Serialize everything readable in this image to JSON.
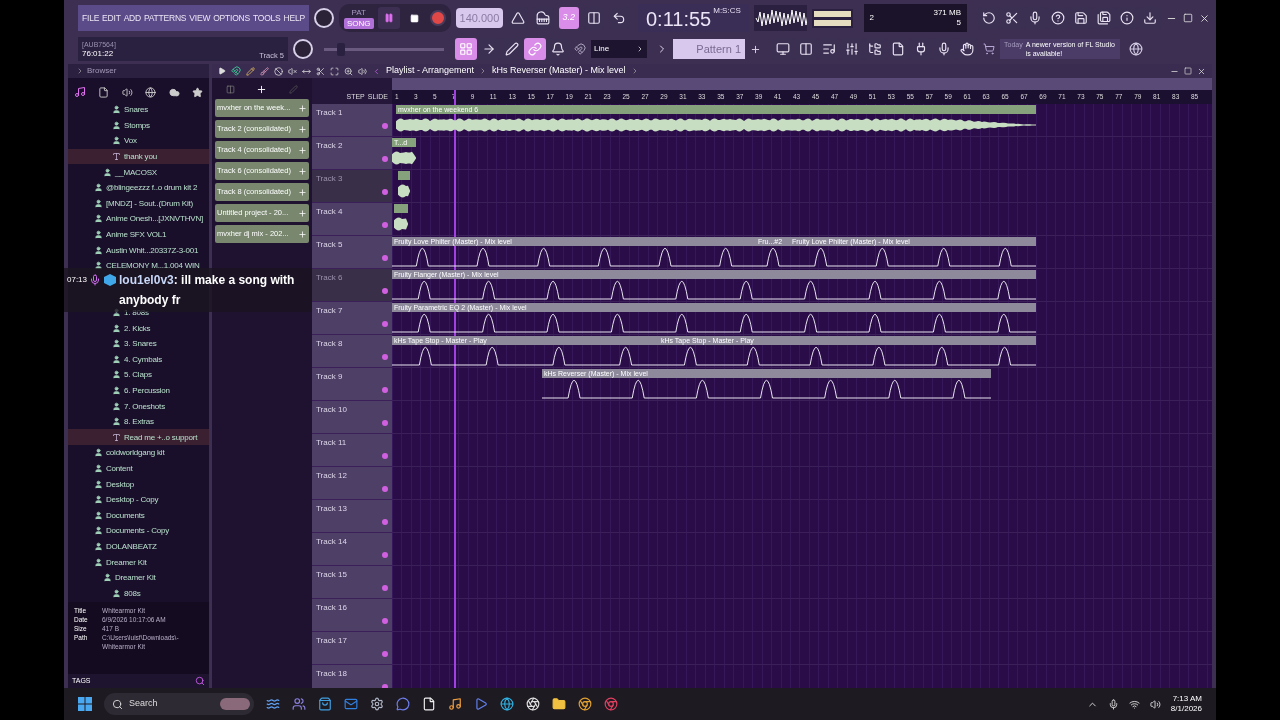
{
  "menu": [
    "FILE",
    "EDIT",
    "ADD",
    "PATTERNS",
    "VIEW",
    "OPTIONS",
    "TOOLS",
    "HELP"
  ],
  "mode_switch": [
    {
      "label": "PAT",
      "selected": false
    },
    {
      "label": "SONG",
      "selected": true
    }
  ],
  "tempo": "140.000",
  "snap_toggle": {
    "label": "3.2",
    "on": true
  },
  "time": {
    "value": "0:11:55",
    "unit": "M:S:CS"
  },
  "resources": {
    "cores": "2",
    "memory": "371 MB",
    "polyphony": "5"
  },
  "hint": {
    "code": "[AUB7564]",
    "position": "76:01:22",
    "target": "Track 5"
  },
  "master_pitch": {
    "level": 0.12
  },
  "tool_toggles": [
    {
      "on": true
    },
    {
      "on": false
    },
    {
      "on": false
    },
    {
      "on": true
    },
    {
      "on": false
    }
  ],
  "snap": "Line",
  "pattern": "Pattern 1",
  "news": {
    "date": "Today",
    "message": "A newer version of FL Studio is available!"
  },
  "browser": {
    "title": "Browser",
    "tree": [
      {
        "kind": "scrolled",
        "children": [
          {
            "kind": "scrolled",
            "children": [
              {
                "kind": "folder",
                "label": "Snares",
                "selected": false
              },
              {
                "kind": "folder",
                "label": "Stomps",
                "selected": false
              },
              {
                "kind": "folder",
                "label": "Vox",
                "selected": false
              },
              {
                "kind": "text",
                "label": "thank you",
                "selected": true
              }
            ]
          },
          {
            "kind": "folder",
            "label": "__MACOSX",
            "selected": false
          }
        ]
      },
      {
        "kind": "folder",
        "label": "@blingeezzz f..o drum kit 2",
        "selected": false
      },
      {
        "kind": "folder",
        "label": "[MNDZ] - Sout..(Drum Kit)",
        "selected": false
      },
      {
        "kind": "folder",
        "label": "Anime Onesh...[JXNVTHVN]",
        "selected": false
      },
      {
        "kind": "folder",
        "label": "Anime SFX VOL1",
        "selected": false
      },
      {
        "kind": "folder",
        "label": "Austin Whit...20337Z-3-001",
        "selected": false
      },
      {
        "kind": "folder",
        "label": "CELEMONY M...1.004 WIN",
        "selected": false
      },
      {
        "kind": "covered",
        "children": [
          {
            "kind": "covered",
            "children": [
              {
                "kind": "folder",
                "label": "1. 808s",
                "selected": false
              },
              {
                "kind": "folder",
                "label": "2. Kicks",
                "selected": false
              },
              {
                "kind": "folder",
                "label": "3. Snares",
                "selected": false
              },
              {
                "kind": "folder",
                "label": "4. Cymbals",
                "selected": false
              },
              {
                "kind": "folder",
                "label": "5. Claps",
                "selected": false
              },
              {
                "kind": "folder",
                "label": "6. Percussion",
                "selected": false
              },
              {
                "kind": "folder",
                "label": "7. Oneshots",
                "selected": false
              },
              {
                "kind": "folder",
                "label": "8. Extras",
                "selected": false
              },
              {
                "kind": "text",
                "label": "Read me +..o support",
                "selected": true
              }
            ]
          }
        ]
      },
      {
        "kind": "folder",
        "label": "coldworldgang kit",
        "selected": false
      },
      {
        "kind": "folder",
        "label": "Content",
        "selected": false
      },
      {
        "kind": "folder",
        "label": "Desktop",
        "selected": false
      },
      {
        "kind": "folder",
        "label": "Desktop - Copy",
        "selected": false
      },
      {
        "kind": "folder",
        "label": "Documents",
        "selected": false
      },
      {
        "kind": "folder",
        "label": "Documents - Copy",
        "selected": false
      },
      {
        "kind": "folder",
        "label": "DOLANBEATZ",
        "selected": false
      },
      {
        "kind": "folder",
        "label": "Dreamer Kit",
        "selected": false,
        "children": [
          {
            "kind": "folder",
            "label": "Dreamer Kit",
            "selected": false,
            "children": [
              {
                "kind": "folder",
                "label": "808s",
                "selected": false
              }
            ]
          }
        ]
      }
    ],
    "info": [
      {
        "key": "Title",
        "value": "Whitearmor Kit"
      },
      {
        "key": "Date",
        "value": "6/9/2026 10:17:06 AM"
      },
      {
        "key": "Size",
        "value": "417 B"
      },
      {
        "key": "Path",
        "value": "C:\\Users\\luisf\\Downloads\\-Whitearmor Kit"
      }
    ],
    "tags_label": "TAGS"
  },
  "patterns": [
    "mvxher on the week...",
    "Track 2 (consolidated)",
    "Track 4 (consolidated)",
    "Track 6 (consolidated)",
    "Track 8 (consolidated)",
    "Untitled project - 20...",
    "mvxher dj mix - 202..."
  ],
  "playlist": {
    "title": "Playlist - Arrangement",
    "breadcrumb": "kHs Reverser (Master) - Mix level",
    "step_label": "STEP",
    "slide_label": "SLIDE",
    "ruler": [
      "1",
      "3",
      "5",
      "7",
      "9",
      "11",
      "13",
      "15",
      "17",
      "19",
      "21",
      "23",
      "25",
      "27",
      "29",
      "31",
      "33",
      "35",
      "37",
      "39",
      "41",
      "43",
      "45",
      "47",
      "49",
      "51",
      "53",
      "55",
      "57",
      "59",
      "61",
      "63",
      "65",
      "67",
      "69",
      "71",
      "73",
      "75",
      "77",
      "79",
      "81",
      "83",
      "85"
    ],
    "tracks": [
      {
        "name": "Track 1",
        "muted": false,
        "clips": [
          {
            "kind": "audio",
            "label": "mvxher on the weekend 6"
          }
        ]
      },
      {
        "name": "Track 2",
        "muted": false,
        "clips": [
          {
            "kind": "audio",
            "label": "T...d"
          }
        ]
      },
      {
        "name": "Track 3",
        "muted": true,
        "clips": [
          {
            "kind": "audio"
          }
        ]
      },
      {
        "name": "Track 4",
        "muted": false,
        "clips": [
          {
            "kind": "audio"
          }
        ]
      },
      {
        "name": "Track 5",
        "muted": false,
        "clips": [
          {
            "kind": "automation",
            "label": "Fruity Love Philter (Master) - Mix level"
          },
          {
            "kind": "automation",
            "label": "Fru...#2"
          },
          {
            "kind": "automation",
            "label": "Fruity Love Philter (Master) - Mix level"
          }
        ]
      },
      {
        "name": "Track 6",
        "muted": true,
        "clips": [
          {
            "kind": "automation",
            "label": "Fruity Flanger (Master) - Mix level"
          }
        ]
      },
      {
        "name": "Track 7",
        "muted": false,
        "clips": [
          {
            "kind": "automation",
            "label": "Fruity Parametric EQ 2 (Master) - Mix level"
          }
        ]
      },
      {
        "name": "Track 8",
        "muted": false,
        "clips": [
          {
            "kind": "automation",
            "label": "kHs Tape Stop - Master - Play"
          },
          {
            "kind": "automation",
            "label": "kHs Tape Stop - Master - Play"
          }
        ]
      },
      {
        "name": "Track 9",
        "muted": false,
        "clips": [
          {
            "kind": "automation",
            "label": "kHs Reverser (Master) - Mix level"
          }
        ]
      },
      {
        "name": "Track 10",
        "muted": false
      },
      {
        "name": "Track 11",
        "muted": false
      },
      {
        "name": "Track 12",
        "muted": false
      },
      {
        "name": "Track 13",
        "muted": false
      },
      {
        "name": "Track 14",
        "muted": false
      },
      {
        "name": "Track 15",
        "muted": false
      },
      {
        "name": "Track 16",
        "muted": false
      },
      {
        "name": "Track 17",
        "muted": false
      },
      {
        "name": "Track 18",
        "muted": false
      }
    ]
  },
  "chat": {
    "time": "07:13",
    "user": "lou1el0v3",
    "message": ": ill make a song with anybody fr"
  },
  "taskbar": {
    "search": "Search",
    "time": "7:13 AM",
    "date": "8/1/2026"
  }
}
